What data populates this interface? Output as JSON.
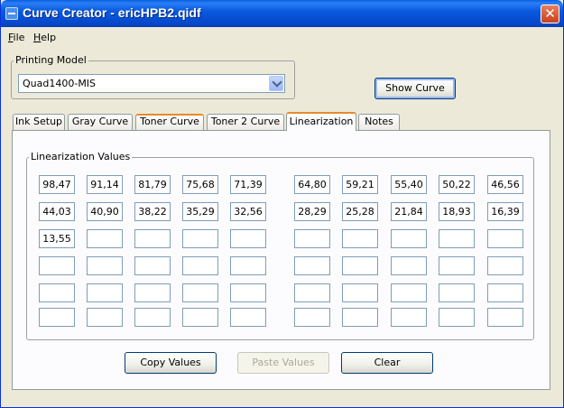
{
  "window": {
    "title": "Curve Creator - ericHPB2.qidf"
  },
  "icons": {
    "app": "app-icon",
    "close": "close-icon",
    "dropdown": "chevron-down-icon"
  },
  "menu": [
    {
      "accel": "F",
      "rest": "ile"
    },
    {
      "accel": "H",
      "rest": "elp"
    }
  ],
  "printing_model": {
    "legend": "Printing Model",
    "selected": "Quad1400-MIS"
  },
  "show_curve_label": "Show Curve",
  "tabs": [
    {
      "label": "Ink Setup",
      "state": "normal"
    },
    {
      "label": "Gray Curve",
      "state": "normal"
    },
    {
      "label": "Toner Curve",
      "state": "hover"
    },
    {
      "label": "Toner 2 Curve",
      "state": "normal"
    },
    {
      "label": "Linearization",
      "state": "active"
    },
    {
      "label": "Notes",
      "state": "normal"
    }
  ],
  "linearization": {
    "legend": "Linearization Values",
    "rows": [
      [
        "98,47",
        "91,14",
        "81,79",
        "75,68",
        "71,39",
        "64,80",
        "59,21",
        "55,40",
        "50,22",
        "46,56"
      ],
      [
        "44,03",
        "40,90",
        "38,22",
        "35,29",
        "32,56",
        "28,29",
        "25,28",
        "21,84",
        "18,93",
        "16,39"
      ],
      [
        "13,55",
        "",
        "",
        "",
        "",
        "",
        "",
        "",
        "",
        ""
      ],
      [
        "",
        "",
        "",
        "",
        "",
        "",
        "",
        "",
        "",
        ""
      ],
      [
        "",
        "",
        "",
        "",
        "",
        "",
        "",
        "",
        "",
        ""
      ],
      [
        "",
        "",
        "",
        "",
        "",
        "",
        "",
        "",
        "",
        ""
      ]
    ]
  },
  "buttons": {
    "copy": "Copy Values",
    "paste": "Paste Values",
    "clear": "Clear"
  },
  "colors": {
    "titlebar": "#0a5ae0",
    "window_bg": "#ece9d8",
    "tab_highlight": "#e68b2c",
    "close_button": "#c9401c"
  }
}
